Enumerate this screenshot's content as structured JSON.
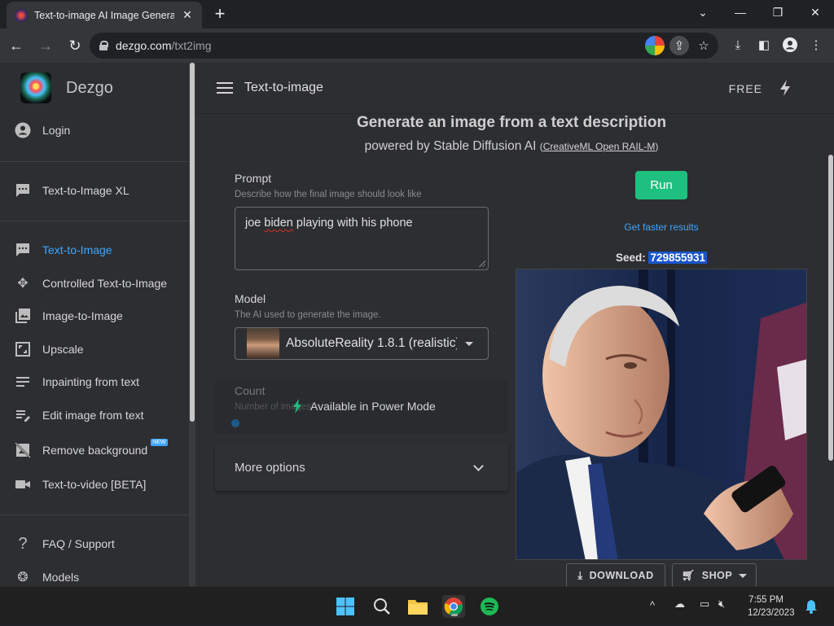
{
  "browser": {
    "tab_title": "Text-to-image AI Image Generato",
    "url_domain": "dezgo.com",
    "url_path": "/txt2img"
  },
  "sidebar": {
    "brand": "Dezgo",
    "login": "Login",
    "sdxl": "Text-to-Image XL",
    "items": [
      {
        "label": "Text-to-Image",
        "icon": "chat-bubble-icon",
        "active": true
      },
      {
        "label": "Controlled Text-to-Image",
        "icon": "move-arrows-icon"
      },
      {
        "label": "Image-to-Image",
        "icon": "images-icon"
      },
      {
        "label": "Upscale",
        "icon": "upscale-frame-icon"
      },
      {
        "label": "Inpainting from text",
        "icon": "text-lines-icon"
      },
      {
        "label": "Edit image from text",
        "icon": "edit-lines-icon"
      },
      {
        "label": "Remove background",
        "icon": "hide-image-icon",
        "badge": "NEW"
      },
      {
        "label": "Text-to-video [BETA]",
        "icon": "video-camera-icon"
      }
    ],
    "faq": "FAQ / Support",
    "models": "Models"
  },
  "appbar": {
    "title": "Text-to-image",
    "plan": "FREE"
  },
  "main": {
    "headline": "Generate an image from a text description",
    "subline": "powered by Stable Diffusion AI",
    "license_open": "(",
    "license": "CreativeML Open RAIL-M",
    "license_close": ")",
    "prompt_label": "Prompt",
    "prompt_hint": "Describe how the final image should look like",
    "prompt_value_a": "joe",
    "prompt_value_b": "biden",
    "prompt_value_c": "playing with his phone",
    "model_label": "Model",
    "model_hint": "The AI used to generate the image.",
    "model_value": "AbsoluteReality 1.8.1 (realistic)",
    "count_label": "Count",
    "count_hint": "Number of images",
    "power_mode": "Available in Power Mode",
    "more_options": "More options",
    "run": "Run",
    "faster": "Get faster results",
    "seed_label": "Seed:",
    "seed_value": "729855931",
    "download": "DOWNLOAD",
    "shop": "SHOP"
  },
  "taskbar": {
    "time": "7:55 PM",
    "date": "12/23/2023"
  },
  "colors": {
    "accent_green": "#1fbf7f",
    "link_blue": "#3ea6ff",
    "seed_highlight": "#1a56c9"
  }
}
